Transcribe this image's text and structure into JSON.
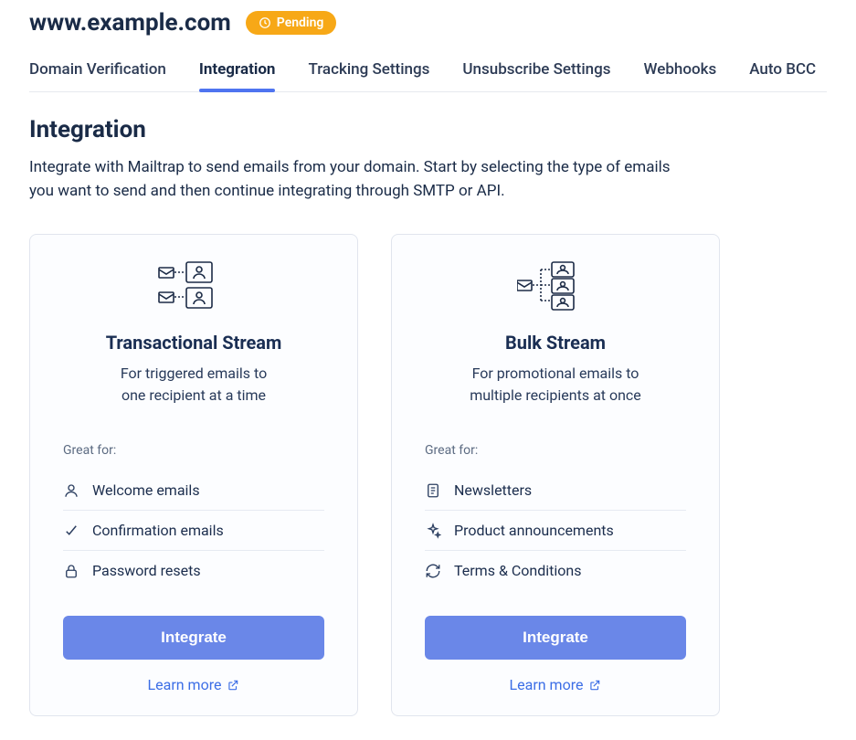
{
  "header": {
    "domain": "www.example.com",
    "status_badge": "Pending"
  },
  "tabs": [
    {
      "label": "Domain Verification",
      "active": false
    },
    {
      "label": "Integration",
      "active": true
    },
    {
      "label": "Tracking Settings",
      "active": false
    },
    {
      "label": "Unsubscribe Settings",
      "active": false
    },
    {
      "label": "Webhooks",
      "active": false
    },
    {
      "label": "Auto BCC",
      "active": false
    }
  ],
  "section": {
    "title": "Integration",
    "description": "Integrate with Mailtrap to send emails from your domain. Start by selecting the type of emails you want to send and then continue integrating through SMTP or API."
  },
  "cards": {
    "transactional": {
      "title": "Transactional Stream",
      "subtitle": "For triggered emails to\none recipient at a time",
      "great_for_label": "Great for:",
      "features": [
        {
          "icon": "user-icon",
          "label": "Welcome emails"
        },
        {
          "icon": "check-icon",
          "label": "Confirmation emails"
        },
        {
          "icon": "lock-icon",
          "label": "Password resets"
        }
      ],
      "button": "Integrate",
      "link": "Learn more"
    },
    "bulk": {
      "title": "Bulk Stream",
      "subtitle": "For promotional emails to\nmultiple recipients at once",
      "great_for_label": "Great for:",
      "features": [
        {
          "icon": "document-icon",
          "label": "Newsletters"
        },
        {
          "icon": "sparkle-icon",
          "label": "Product announcements"
        },
        {
          "icon": "refresh-icon",
          "label": "Terms & Conditions"
        }
      ],
      "button": "Integrate",
      "link": "Learn more"
    }
  }
}
